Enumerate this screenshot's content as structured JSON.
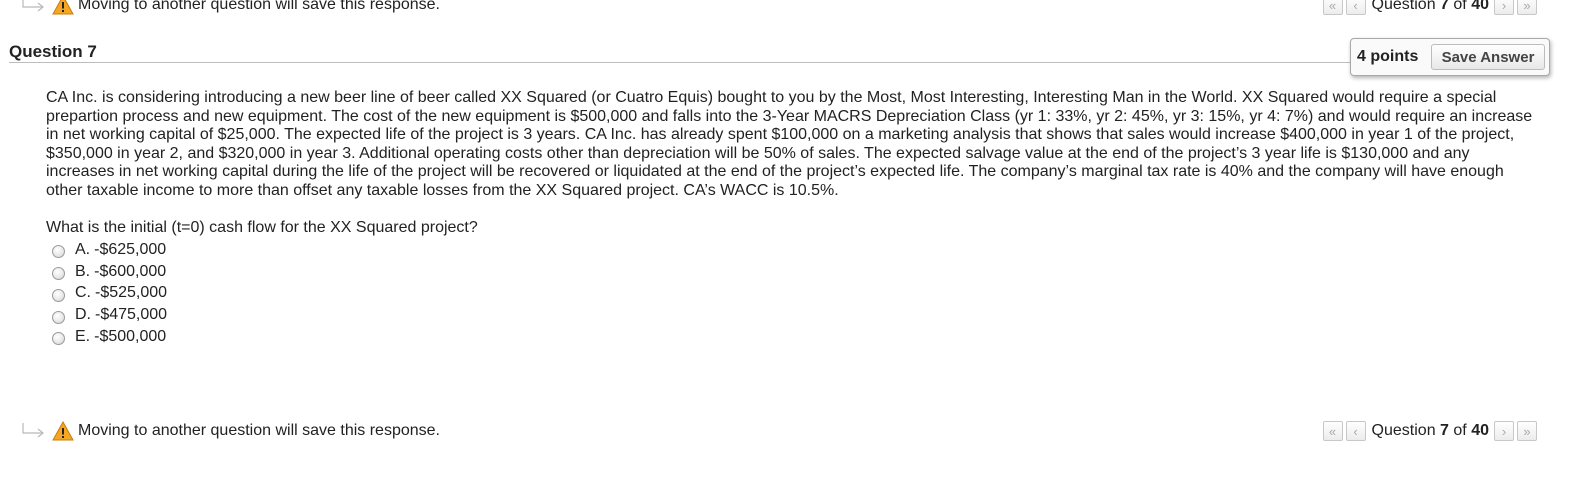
{
  "navigation": {
    "warning_text": "Moving to another question will save this response.",
    "question_word": "Question",
    "current": "7",
    "of_word": "of",
    "total": "40"
  },
  "question": {
    "title": "Question 7",
    "points": "4 points",
    "save_label": "Save Answer",
    "body": "CA Inc.  is considering introducing a new beer line of beer called XX Squared (or Cuatro Equis) bought to you by the Most, Most Interesting, Interesting Man in the World.  XX Squared would require a special prepartion process and new equipment.  The cost of the new equipment is $500,000 and falls into the 3-Year MACRS Depreciation Class (yr 1: 33%, yr 2: 45%, yr 3: 15%, yr 4: 7%) and would require an increase in net working capital of $25,000.  The expected life of the project is 3 years. CA Inc. has already spent $100,000 on a marketing analysis that shows that sales would increase $400,000 in year 1 of the project, $350,000 in year 2, and $320,000 in year 3.  Additional operating costs other than depreciation will be 50% of sales.  The expected salvage value at the end of the project’s 3 year life is $130,000 and any increases in net working capital during the life of the project will be recovered or liquidated at the end of the project’s expected life.  The company’s marginal tax rate is 40% and the company will have enough other taxable income to more than offset any taxable losses from the XX Squared project.  CA’s WACC is 10.5%.",
    "prompt": "What is the initial (t=0) cash flow for the XX Squared project?",
    "options": [
      {
        "letter": "A.",
        "value": "-$625,000"
      },
      {
        "letter": "B.",
        "value": "-$600,000"
      },
      {
        "letter": "C.",
        "value": "-$525,000"
      },
      {
        "letter": "D.",
        "value": "-$475,000"
      },
      {
        "letter": "E.",
        "value": "-$500,000"
      }
    ]
  },
  "colors": {
    "warning_icon": "#f5a623",
    "pager_disabled_glyph": "#a8a8a8",
    "divider": "#bdbdbd"
  },
  "icons": {
    "hint_arrow": "return-arrow-icon",
    "warning": "warning-icon",
    "first": "double-chevron-left-icon",
    "prev": "chevron-left-icon",
    "next": "chevron-right-icon",
    "last": "double-chevron-right-icon"
  }
}
